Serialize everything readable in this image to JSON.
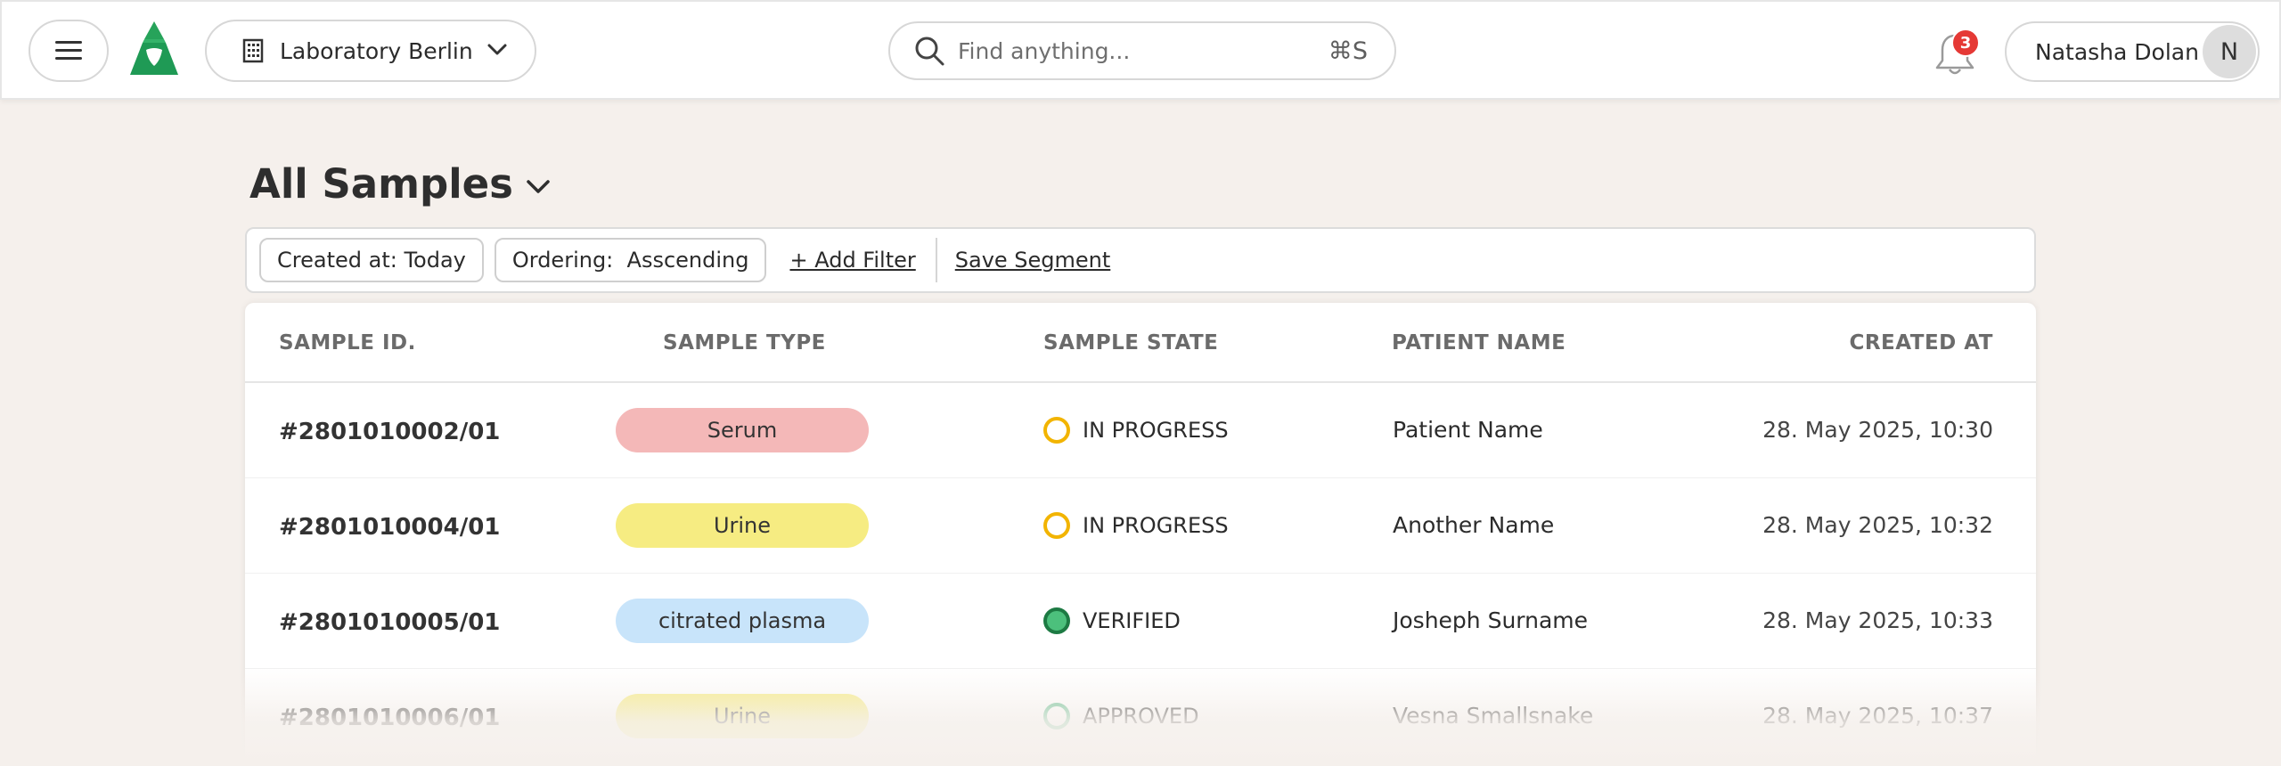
{
  "header": {
    "menu_icon": "hamburger-menu-icon",
    "logo_icon": "green-triangle-logo-icon",
    "lab_select": {
      "icon": "building-icon",
      "label": "Laboratory Berlin"
    },
    "search": {
      "placeholder": "Find anything...",
      "shortcut": "⌘S"
    },
    "notifications": {
      "icon": "bell-icon",
      "count": "3"
    },
    "user": {
      "name": "Natasha Dolan",
      "initial": "N"
    }
  },
  "page": {
    "title": "All Samples"
  },
  "filters": {
    "chips": [
      "Created at: Today",
      "Ordering:  Asscending"
    ],
    "add_filter": "+ Add Filter",
    "save_segment": "Save Segment"
  },
  "table": {
    "columns": [
      "SAMPLE ID.",
      "SAMPLE TYPE",
      "SAMPLE STATE",
      "PATIENT NAME",
      "CREATED AT"
    ],
    "rows": [
      {
        "id": "#2801010002/01",
        "type": "Serum",
        "type_color": "#f4b8b8",
        "state": "IN PROGRESS",
        "state_style": "ring",
        "state_color": "#f2b400",
        "patient": "Patient Name",
        "created": "28. May 2025, 10:30"
      },
      {
        "id": "#2801010004/01",
        "type": "Urine",
        "type_color": "#f6ec82",
        "state": "IN PROGRESS",
        "state_style": "ring",
        "state_color": "#f2b400",
        "patient": "Another Name",
        "created": "28. May 2025, 10:32"
      },
      {
        "id": "#2801010005/01",
        "type": "citrated plasma",
        "type_color": "#c8e4fa",
        "state": "VERIFIED",
        "state_style": "filled",
        "state_color": "#2e9e5b",
        "patient": "Josheph Surname",
        "created": "28. May 2025, 10:33"
      },
      {
        "id": "#2801010006/01",
        "type": "Urine",
        "type_color": "#f6ec82",
        "state": "APPROVED",
        "state_style": "ring",
        "state_color": "#5dbb8a",
        "patient": "Vesna Smallsnake",
        "created": "28. May 2025, 10:37"
      }
    ]
  }
}
